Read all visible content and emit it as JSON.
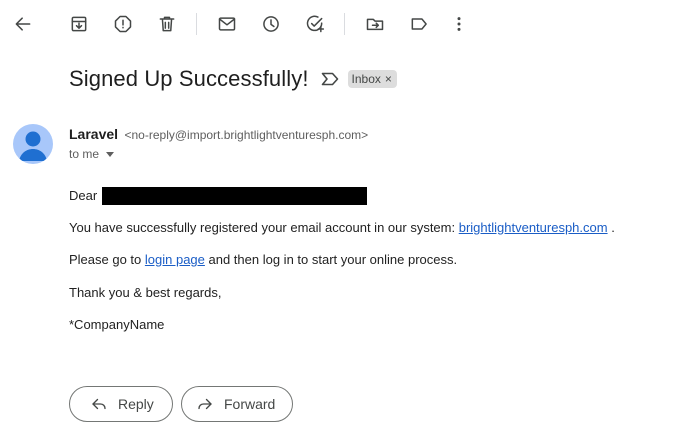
{
  "toolbar": {
    "icons": [
      "back-arrow-icon",
      "archive-icon",
      "report-spam-icon",
      "delete-icon",
      "mark-unread-icon",
      "snooze-icon",
      "add-to-tasks-icon",
      "move-to-icon",
      "label-icon",
      "more-vert-icon"
    ]
  },
  "email": {
    "subject": "Signed Up Successfully!",
    "label_chip": "Inbox",
    "label_chip_close": "×",
    "sender_name": "Laravel",
    "sender_email": "<no-reply@import.brightlightventuresph.com>",
    "to_line": "to me",
    "body": {
      "greeting": "Dear",
      "line1_prefix": "You have successfully registered your email account in our system: ",
      "line1_link": "brightlightventuresph.com",
      "line1_suffix": " .",
      "line2_prefix": "Please go to ",
      "line2_link": "login page",
      "line2_suffix": " and then log in to start your online process.",
      "closing": "Thank you & best regards,",
      "signature": "*CompanyName"
    }
  },
  "actions": {
    "reply_label": "Reply",
    "forward_label": "Forward"
  },
  "colors": {
    "link": "#1a5dc6",
    "avatar_bg": "#a8c7fa",
    "avatar_fg": "#1f6fd1",
    "chip_bg": "#dddddd"
  }
}
